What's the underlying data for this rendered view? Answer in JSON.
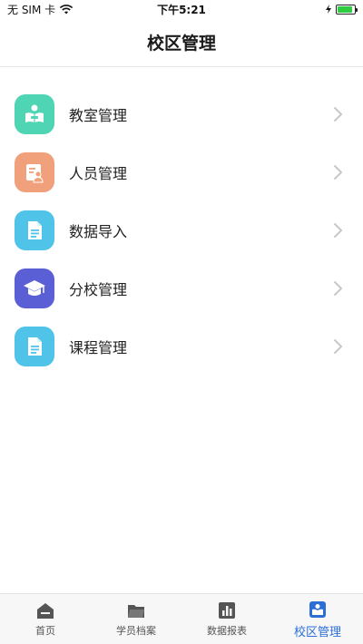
{
  "status_bar": {
    "carrier": "无 SIM 卡",
    "time": "下午5:21",
    "wifi_icon": "wifi-icon",
    "battery_icon": "battery-icon",
    "battery_level": 0.9
  },
  "header": {
    "title": "校区管理"
  },
  "menu": {
    "items": [
      {
        "label": "教室管理",
        "icon": "classroom-icon",
        "color": "#4fd5b3"
      },
      {
        "label": "人员管理",
        "icon": "personnel-icon",
        "color": "#f0a07a"
      },
      {
        "label": "数据导入",
        "icon": "document-icon",
        "color": "#4fc3e8"
      },
      {
        "label": "分校管理",
        "icon": "graduation-cap-icon",
        "color": "#5b5fd6"
      },
      {
        "label": "课程管理",
        "icon": "document-icon",
        "color": "#4fc3e8"
      }
    ]
  },
  "tab_bar": {
    "tabs": [
      {
        "label": "首页",
        "icon": "home-icon",
        "active": false
      },
      {
        "label": "学员档案",
        "icon": "folder-icon",
        "active": false
      },
      {
        "label": "数据报表",
        "icon": "bar-chart-icon",
        "active": false
      },
      {
        "label": "校区管理",
        "icon": "campus-icon",
        "active": true
      }
    ],
    "active_color": "#2b6fd6",
    "inactive_color": "#555555"
  }
}
